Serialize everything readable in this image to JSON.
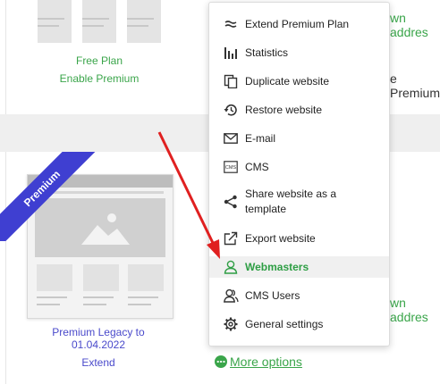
{
  "free_card": {
    "plan_label": "Free Plan",
    "action_label": "Enable Premium"
  },
  "right_column": {
    "top_link_fragment": "wn addres",
    "premium_fragment": "e Premium",
    "bottom_link_fragment": "wn addres"
  },
  "premium_card": {
    "ribbon": "Premium",
    "title": "Premium Legacy to 01.04.2022",
    "action_label": "Extend"
  },
  "more_options": {
    "label": "More options"
  },
  "menu": {
    "items": [
      {
        "label": "Extend Premium Plan",
        "icon": "extend-icon"
      },
      {
        "label": "Statistics",
        "icon": "statistics-icon"
      },
      {
        "label": "Duplicate website",
        "icon": "duplicate-icon"
      },
      {
        "label": "Restore website",
        "icon": "restore-icon"
      },
      {
        "label": "E-mail",
        "icon": "email-icon"
      },
      {
        "label": "CMS",
        "icon": "cms-icon"
      },
      {
        "label": "Share website as a template",
        "icon": "share-icon"
      },
      {
        "label": "Export website",
        "icon": "export-icon"
      },
      {
        "label": "Webmasters",
        "icon": "webmasters-icon",
        "active": true
      },
      {
        "label": "CMS Users",
        "icon": "cms-users-icon"
      },
      {
        "label": "General settings",
        "icon": "settings-icon"
      }
    ]
  },
  "colors": {
    "accent_green": "#3aa54a",
    "premium_ribbon": "#3f3fd1",
    "link_blue": "#4a4acb",
    "arrow_red": "#e02020"
  }
}
